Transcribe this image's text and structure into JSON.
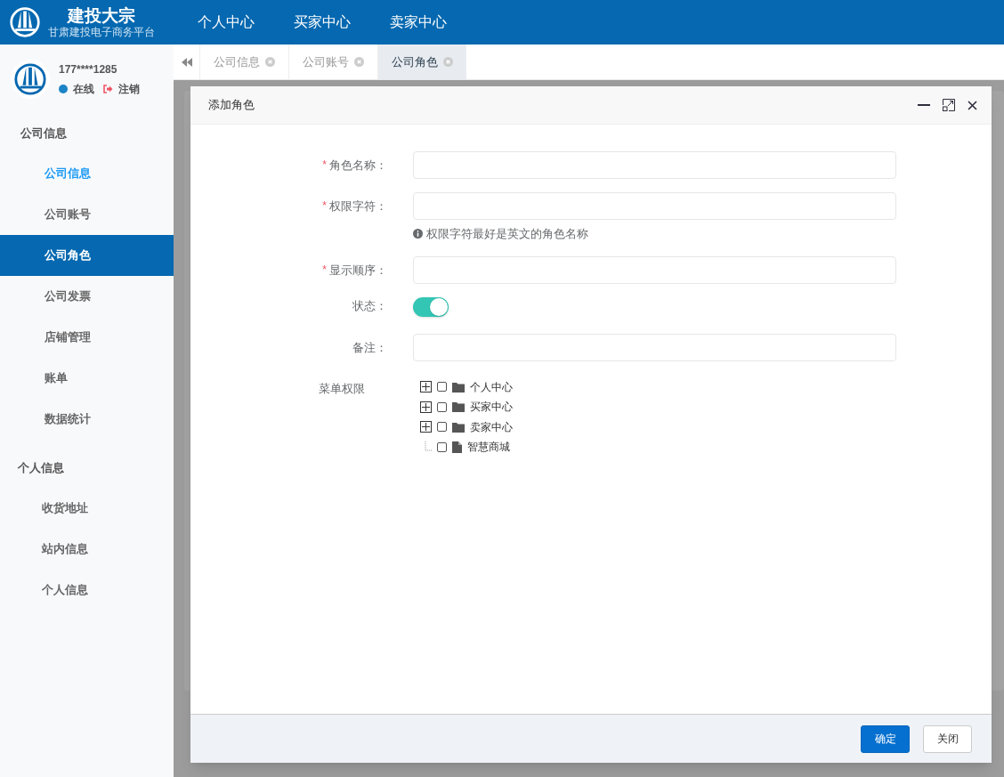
{
  "brand": {
    "name": "建投大宗",
    "subtitle": "甘肃建投电子商务平台"
  },
  "top_nav": [
    {
      "label": "个人中心"
    },
    {
      "label": "买家中心"
    },
    {
      "label": "卖家中心"
    }
  ],
  "user": {
    "phone": "177****1285",
    "status": "在线",
    "online": true,
    "logout": "注销"
  },
  "sidebar": [
    {
      "label": "公司信息",
      "items": [
        {
          "label": "公司信息",
          "selected": false,
          "active": true
        },
        {
          "label": "公司账号",
          "selected": false,
          "active": false
        },
        {
          "label": "公司角色",
          "selected": true,
          "active": false
        },
        {
          "label": "公司发票",
          "selected": false,
          "active": false
        },
        {
          "label": "店铺管理",
          "selected": false,
          "active": false
        },
        {
          "label": "账单",
          "selected": false,
          "active": false
        },
        {
          "label": "数据统计",
          "selected": false,
          "active": false
        }
      ]
    },
    {
      "label": "个人信息",
      "items": [
        {
          "label": "收货地址",
          "selected": false,
          "active": false
        },
        {
          "label": "站内信息",
          "selected": false,
          "active": false
        },
        {
          "label": "个人信息",
          "selected": false,
          "active": false
        }
      ]
    }
  ],
  "tabs": [
    {
      "label": "公司信息",
      "selected": false
    },
    {
      "label": "公司账号",
      "selected": false
    },
    {
      "label": "公司角色",
      "selected": true
    }
  ],
  "dialog": {
    "title": "添加角色",
    "fields": [
      {
        "kind": "input",
        "label": "角色名称：",
        "required_mark": "*"
      },
      {
        "kind": "input",
        "label": "权限字符：",
        "required_mark": "*",
        "hint": "权限字符最好是英文的角色名称"
      },
      {
        "kind": "input",
        "label": "显示顺序：",
        "required_mark": "*"
      },
      {
        "kind": "switch",
        "label": "状态：",
        "on": true
      },
      {
        "kind": "input",
        "label": "备注："
      },
      {
        "kind": "tree",
        "label": "菜单权限"
      }
    ],
    "tree": [
      {
        "kind": "folder",
        "label": "个人中心",
        "checked": false,
        "expanded": false
      },
      {
        "kind": "folder",
        "label": "买家中心",
        "checked": false,
        "expanded": false
      },
      {
        "kind": "folder",
        "label": "卖家中心",
        "checked": false,
        "expanded": false
      },
      {
        "kind": "file",
        "label": "智慧商城",
        "checked": false
      }
    ],
    "buttons": [
      {
        "label": "确定",
        "kind": "primary"
      },
      {
        "label": "关闭",
        "kind": "default"
      }
    ]
  }
}
